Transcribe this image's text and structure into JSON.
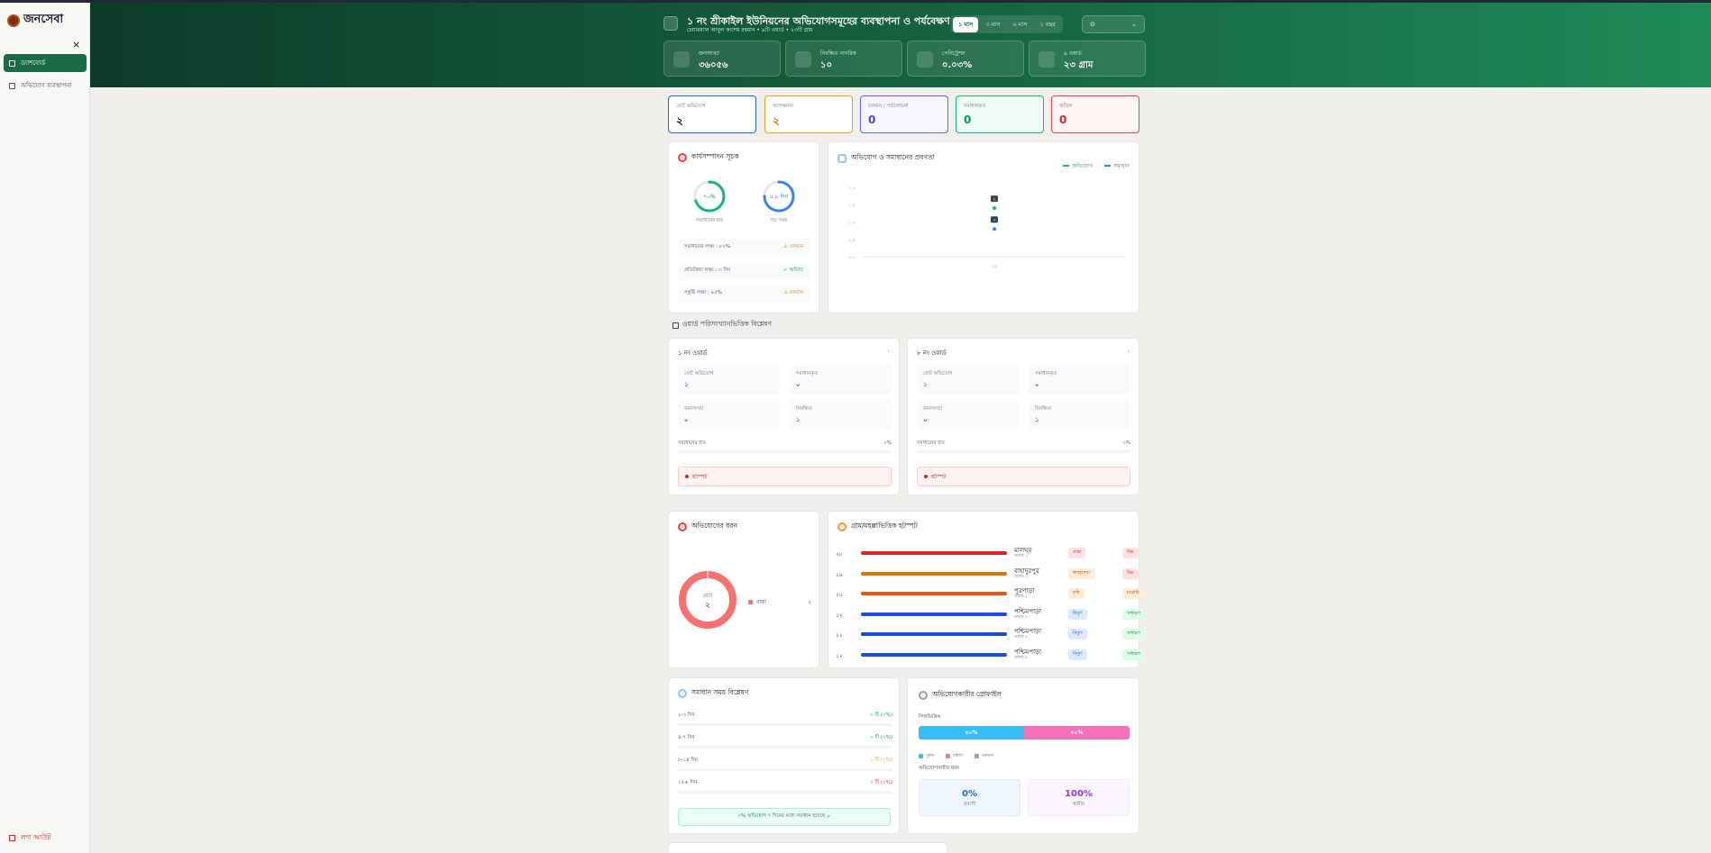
{
  "app": {
    "name": "জনসেবা"
  },
  "sidebar": {
    "close_label": "×",
    "items": [
      {
        "label": "ড্যাশবোর্ড",
        "active": true
      },
      {
        "label": "অভিযোগ ব্যবস্থাপনা",
        "active": false
      }
    ],
    "logout_label": "লগ আউট"
  },
  "header": {
    "title": "১ নং শ্রীকাইল ইউনিয়নের অভিযোগসমূহের ব্যবস্থাপনা ও পর্যবেক্ষণ",
    "subtitle": "চেয়ারম্যান আবুল কাশেম রহমান • ৯টি ওয়ার্ড • ২৩টি গ্রাম",
    "range_tabs": [
      {
        "label": "১ মাস",
        "active": true
      },
      {
        "label": "৩ মাস",
        "active": false
      },
      {
        "label": "৬ মাস",
        "active": false
      },
      {
        "label": "১ বছর",
        "active": false
      }
    ],
    "filter_icon": "pin-icon",
    "stats": [
      {
        "label": "জনসংখ্যা",
        "value": "৩৬০৫৬",
        "icon": "users-icon"
      },
      {
        "label": "নিবন্ধিত নাগরিক",
        "value": "১০",
        "icon": "phone-icon"
      },
      {
        "label": "পেনিট্রেশন",
        "value": "০.০৩%",
        "icon": "chart-icon"
      },
      {
        "label": "৯ ওয়ার্ড",
        "value": "২৩ গ্রাম",
        "icon": "building-icon"
      }
    ]
  },
  "status_cards": [
    {
      "label": "মোট অভিযোগ",
      "value": "২",
      "color": "#2563eb"
    },
    {
      "label": "অপেক্ষমান",
      "value": "২",
      "color": "#f59e0b"
    },
    {
      "label": "চলমান / পর্যালোচনা",
      "value": "0",
      "color": "#4f46e5"
    },
    {
      "label": "সমাধানকৃত",
      "value": "0",
      "color": "#059669"
    },
    {
      "label": "বাতিল",
      "value": "0",
      "color": "#dc2626"
    }
  ],
  "kpi": {
    "title": "কার্যসম্পাদন সূচক",
    "gauges": [
      {
        "value": "৭০%",
        "label": "সমাধানের হার",
        "color": "#10b981",
        "fraction": 0.7
      },
      {
        "value": "৫.৮ দিন",
        "label": "গড় সময়",
        "color": "#3b82f6",
        "fraction": 0.75
      }
    ],
    "rows": [
      {
        "label": "সমাধানের লক্ষ্য : ৮০%",
        "status": "চলমান",
        "status_color": "#f59e0b",
        "icon": "warning-icon"
      },
      {
        "label": "প্রতিক্রিয়া লক্ষ্য : ৩ দিন",
        "status": "অর্জিত",
        "status_color": "#059669",
        "icon": "check-icon"
      },
      {
        "label": "সন্তুষ্টি লক্ষ্য : ৯৫%",
        "status": "চলমান",
        "status_color": "#f59e0b",
        "icon": "warning-icon"
      }
    ]
  },
  "trend": {
    "title": "অভিযোগ ও সমাধানের প্রবণতা",
    "legend": [
      {
        "label": "অভিযোগ",
        "color": "#10b981"
      },
      {
        "label": "সমাধান",
        "color": "#3b82f6"
      }
    ]
  },
  "chart_data": {
    "type": "line",
    "title": "অভিযোগ ও সমাধানের প্রবণতা",
    "categories": [
      "২৫"
    ],
    "y_ticks": [
      "০.০",
      "০.৫",
      "১.০",
      "১.৫",
      "২.০"
    ],
    "ylim": [
      0,
      2
    ],
    "series": [
      {
        "name": "অভিযোগ",
        "values": [
          1.4
        ],
        "point_label": "২",
        "color": "#10b981"
      },
      {
        "name": "সমাধান",
        "values": [
          0.8
        ],
        "point_label": "০",
        "color": "#3b82f6"
      }
    ],
    "grid": false,
    "legend_position": "top-right"
  },
  "wards": {
    "section_title": "ওয়ার্ড পরিসংখ্যানভিত্তিক বিশ্লেষণ",
    "items": [
      {
        "title": "১ নং ওয়ার্ড",
        "cells": [
          {
            "label": "মোট অভিযোগ",
            "value": "১"
          },
          {
            "label": "সমাধানকৃত",
            "value": "০"
          },
          {
            "label": "জনসংখ্যা",
            "value": "০"
          },
          {
            "label": "নিবন্ধিত",
            "value": "১"
          }
        ],
        "rate_label": "সমাধানের হার",
        "rate_value": "০%",
        "rate_fraction": 0,
        "hotspot": "হটস্পট"
      },
      {
        "title": "৮ নং ওয়ার্ড",
        "cells": [
          {
            "label": "মোট অভিযোগ",
            "value": "১"
          },
          {
            "label": "সমাধানকৃত",
            "value": "০"
          },
          {
            "label": "জনসংখ্যা",
            "value": "০"
          },
          {
            "label": "নিবন্ধিত",
            "value": "১"
          }
        ],
        "rate_label": "সমাধানের হার",
        "rate_value": "০%",
        "rate_fraction": 0,
        "hotspot": "হটস্পট"
      }
    ]
  },
  "types": {
    "title": "অভিযোগের ধরন",
    "donut_label": "মোট",
    "donut_value": "২",
    "legend": [
      {
        "label": "রাস্তা",
        "value": "২",
        "color": "#f87171"
      }
    ]
  },
  "hotspots": {
    "title": "গ্রাম/মহল্লাভিত্তিক হটস্পট",
    "rows": [
      {
        "num": "২৮",
        "name": "মালঘর",
        "sub": "ওয়ার্ড ১",
        "category": "রাস্তা",
        "level": "উচ্চ",
        "bar_color": "#dc2626",
        "cat_bg": "#fee2e2",
        "cat_color": "#dc2626",
        "lvl_bg": "#fee2e2",
        "lvl_color": "#dc2626",
        "fraction": 1.0
      },
      {
        "num": "১৯",
        "name": "বাহাদুরপুর",
        "sub": "ওয়ার্ড ৩",
        "category": "স্বাস্থ্যসেবা",
        "level": "উচ্চ",
        "bar_color": "#d97706",
        "cat_bg": "#ffedd5",
        "cat_color": "#c2410c",
        "lvl_bg": "#fee2e2",
        "lvl_color": "#dc2626",
        "fraction": 1.0
      },
      {
        "num": "১৫",
        "name": "পুরপাড়া",
        "sub": "ওয়ার্ড ৫",
        "category": "কৃষি",
        "level": "মাঝারি",
        "bar_color": "#ea580c",
        "cat_bg": "#ffedd5",
        "cat_color": "#c2410c",
        "lvl_bg": "#ffedd5",
        "lvl_color": "#c2410c",
        "fraction": 1.0
      },
      {
        "num": "১২",
        "name": "পশ্চিমপাড়া",
        "sub": "ওয়ার্ড ১",
        "category": "বিদ্যুৎ",
        "level": "সাধারণ",
        "bar_color": "#1d4ed8",
        "cat_bg": "#dbeafe",
        "cat_color": "#1d4ed8",
        "lvl_bg": "#dcfce7",
        "lvl_color": "#15803d",
        "fraction": 1.0
      },
      {
        "num": "১২",
        "name": "পশ্চিমপাড়া",
        "sub": "ওয়ার্ড ২",
        "category": "বিদ্যুৎ",
        "level": "সাধারণ",
        "bar_color": "#1d4ed8",
        "cat_bg": "#dbeafe",
        "cat_color": "#1d4ed8",
        "lvl_bg": "#dcfce7",
        "lvl_color": "#15803d",
        "fraction": 1.0
      },
      {
        "num": "১২",
        "name": "পশ্চিমপাড়া",
        "sub": "ওয়ার্ড ৪",
        "category": "বিদ্যুৎ",
        "level": "সাধারণ",
        "bar_color": "#1d4ed8",
        "cat_bg": "#dbeafe",
        "cat_color": "#1d4ed8",
        "lvl_bg": "#dcfce7",
        "lvl_color": "#15803d",
        "fraction": 1.0
      }
    ]
  },
  "resolution": {
    "title": "সমাধান সময় বিশ্লেষণ",
    "rows": [
      {
        "label": "১-৩ দিন",
        "value": "০ টি (০%)",
        "color": "#059669"
      },
      {
        "label": "৪-৭ দিন",
        "value": "০ টি (০%)",
        "color": "#059669"
      },
      {
        "label": "৮-১৪ দিন",
        "value": "০ টি (০%)",
        "color": "#f59e0b"
      },
      {
        "label": "১৫+ দিন",
        "value": "০ টি (০%)",
        "color": "#dc2626"
      }
    ],
    "note": "০% অভিযোগ ৭ দিনের মধ্যে সমাধান হয়েছে"
  },
  "profile": {
    "title": "অভিযোগকারীর প্রোফাইল",
    "gender_label": "লিঙ্গভিত্তিক",
    "gender_segments": [
      {
        "label": "৫০%",
        "color": "#38bdf8",
        "fraction": 0.5
      },
      {
        "label": "৫০%",
        "color": "#f472b6",
        "fraction": 0.5
      }
    ],
    "gender_legend": [
      {
        "label": "পুরুষ",
        "color": "#38bdf8"
      },
      {
        "label": "মহিলা",
        "color": "#f472b6"
      },
      {
        "label": "অন্যান্য",
        "color": "#9ca3af"
      }
    ],
    "type_label": "অভিযোগকারীর ধরন",
    "types": [
      {
        "value": "0%",
        "label": "প্রবাসী",
        "color": "#2563eb",
        "bg": "#eff6ff"
      },
      {
        "value": "100%",
        "label": "স্থানীয়",
        "color": "#9333ea",
        "bg": "#faf5ff"
      }
    ]
  }
}
